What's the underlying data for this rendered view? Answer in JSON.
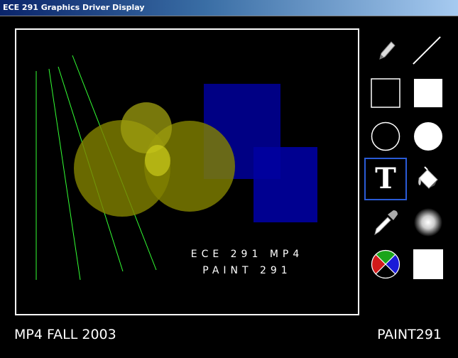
{
  "window": {
    "title": "ECE 291 Graphics Driver Display"
  },
  "canvas": {
    "text_line1": "ECE  291  MP4",
    "text_line2": "PAINT  291"
  },
  "toolbar": {
    "tools": [
      {
        "name": "pencil",
        "icon": "pencil-icon",
        "selected": false
      },
      {
        "name": "line",
        "icon": "line-icon",
        "selected": false
      },
      {
        "name": "rectangle",
        "icon": "rectangle-outline-icon",
        "selected": false
      },
      {
        "name": "filled-rectangle",
        "icon": "rectangle-filled-icon",
        "selected": false
      },
      {
        "name": "circle",
        "icon": "circle-outline-icon",
        "selected": false
      },
      {
        "name": "filled-circle",
        "icon": "circle-filled-icon",
        "selected": false
      },
      {
        "name": "text",
        "icon": "text-icon",
        "label": "T",
        "selected": true
      },
      {
        "name": "fill",
        "icon": "paint-bucket-icon",
        "selected": false
      },
      {
        "name": "eyedropper",
        "icon": "eyedropper-icon",
        "selected": false
      },
      {
        "name": "airbrush",
        "icon": "airbrush-icon",
        "selected": false
      },
      {
        "name": "color-picker",
        "icon": "color-wheel-icon",
        "selected": false
      },
      {
        "name": "current-color",
        "icon": "color-swatch-icon",
        "selected": false
      }
    ]
  },
  "colors": {
    "selection_border": "#2a5bd7",
    "current_color": "#ffffff",
    "shape_yellow": "#808000",
    "shape_blue": "#00008b",
    "line_green": "#33ff33"
  },
  "footer": {
    "left": "MP4 FALL 2003",
    "right": "PAINT291"
  }
}
